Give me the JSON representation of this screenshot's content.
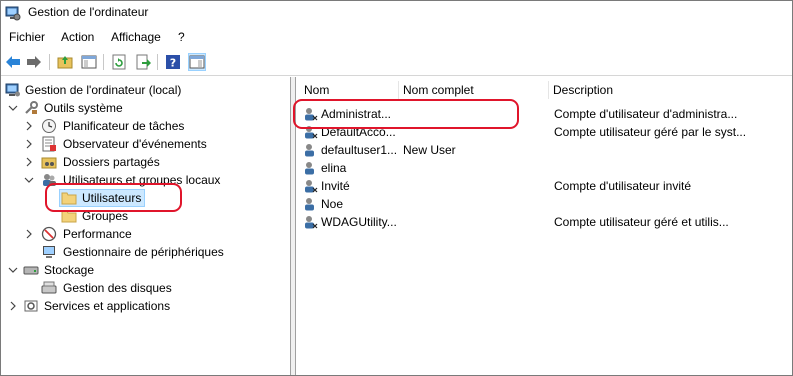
{
  "window": {
    "title": "Gestion de l'ordinateur"
  },
  "menu": [
    "Fichier",
    "Action",
    "Affichage",
    "?"
  ],
  "toolbar": {
    "buttons": [
      "back-icon",
      "forward-icon",
      "up-folder-icon",
      "console-tree-icon",
      "refresh-icon",
      "export-list-icon",
      "help-icon",
      "action-pane-icon"
    ]
  },
  "tree": {
    "root": "Gestion de l'ordinateur (local)",
    "system_tools": "Outils système",
    "task_scheduler": "Planificateur de tâches",
    "event_viewer": "Observateur d'événements",
    "shared_folders": "Dossiers partagés",
    "local_users_groups": "Utilisateurs et groupes locaux",
    "users": "Utilisateurs",
    "groups": "Groupes",
    "performance": "Performance",
    "device_manager": "Gestionnaire de périphériques",
    "storage": "Stockage",
    "disk_management": "Gestion des disques",
    "services_apps": "Services et applications"
  },
  "list": {
    "columns": {
      "name": "Nom",
      "full_name": "Nom complet",
      "description": "Description"
    },
    "rows": [
      {
        "name": "Administrat...",
        "full_name": "",
        "description": "Compte d'utilisateur d'administra..."
      },
      {
        "name": "DefaultAcco...",
        "full_name": "",
        "description": "Compte utilisateur géré par le syst..."
      },
      {
        "name": "defaultuser1...",
        "full_name": "New User",
        "description": ""
      },
      {
        "name": "elina",
        "full_name": "",
        "description": ""
      },
      {
        "name": "Invité",
        "full_name": "",
        "description": "Compte d'utilisateur invité"
      },
      {
        "name": "Noe",
        "full_name": "",
        "description": ""
      },
      {
        "name": "WDAGUtility...",
        "full_name": "",
        "description": "Compte utilisateur géré et utilis..."
      }
    ]
  },
  "colors": {
    "selection": "#cce8ff",
    "annotation": "#e0152b"
  }
}
